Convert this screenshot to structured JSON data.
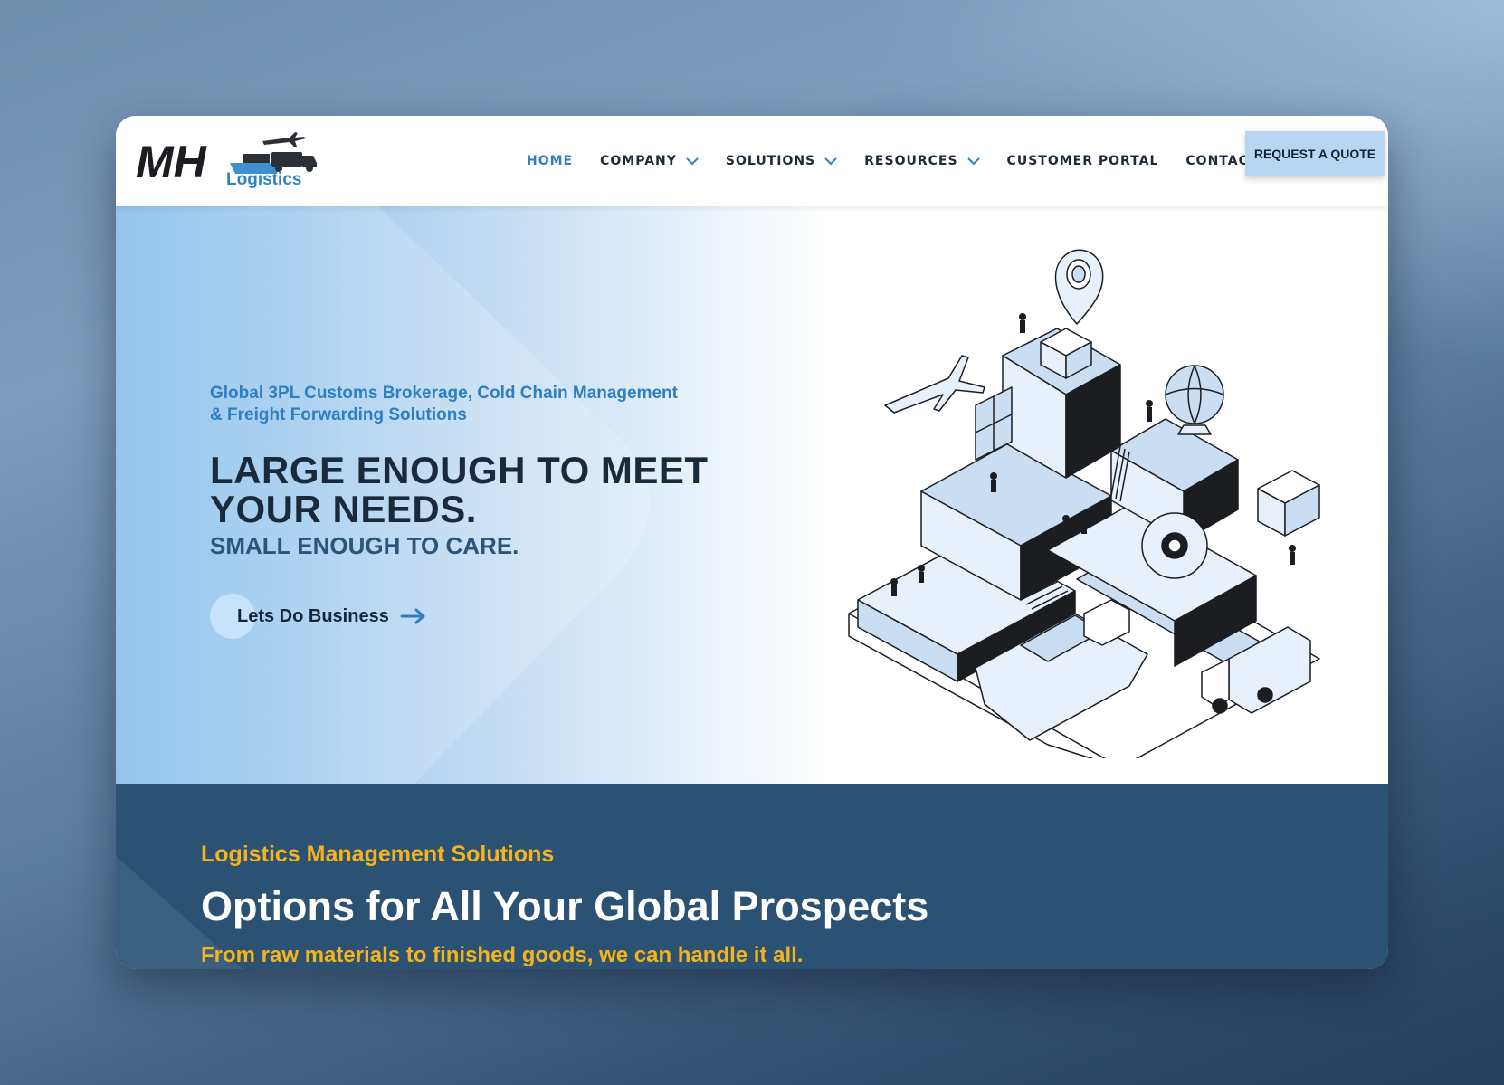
{
  "header": {
    "logo": {
      "primary_text": "MH",
      "secondary_text": "Logistics",
      "icons": [
        "airplane-icon",
        "ship-icon",
        "truck-icon"
      ]
    },
    "nav": [
      {
        "label": "HOME",
        "active": true,
        "has_dropdown": false
      },
      {
        "label": "COMPANY",
        "active": false,
        "has_dropdown": true
      },
      {
        "label": "SOLUTIONS",
        "active": false,
        "has_dropdown": true
      },
      {
        "label": "RESOURCES",
        "active": false,
        "has_dropdown": true
      },
      {
        "label": "CUSTOMER PORTAL",
        "active": false,
        "has_dropdown": false
      },
      {
        "label": "CONTACT US",
        "active": false,
        "has_dropdown": false
      }
    ],
    "quote_button": "REQUEST A QUOTE"
  },
  "hero": {
    "tagline_line1": "Global 3PL Customs Brokerage, Cold Chain Management",
    "tagline_line2": "& Freight Forwarding Solutions",
    "headline_line1": "LARGE ENOUGH TO MEET",
    "headline_line2": "YOUR NEEDS.",
    "subheadline": "SMALL ENOUGH TO CARE.",
    "cta_label": "Lets Do Business",
    "illustration": "isometric-logistics-illustration"
  },
  "solutions": {
    "eyebrow": "Logistics Management Solutions",
    "title": "Options for All Your Global Prospects",
    "subtitle": "From raw materials to finished goods, we can handle it all."
  },
  "colors": {
    "accent_blue": "#2f7fc0",
    "dark_navy": "#1a2a3d",
    "section_blue": "#2b5273",
    "gold": "#f5b41b",
    "button_light_blue": "#b7d6f1"
  }
}
